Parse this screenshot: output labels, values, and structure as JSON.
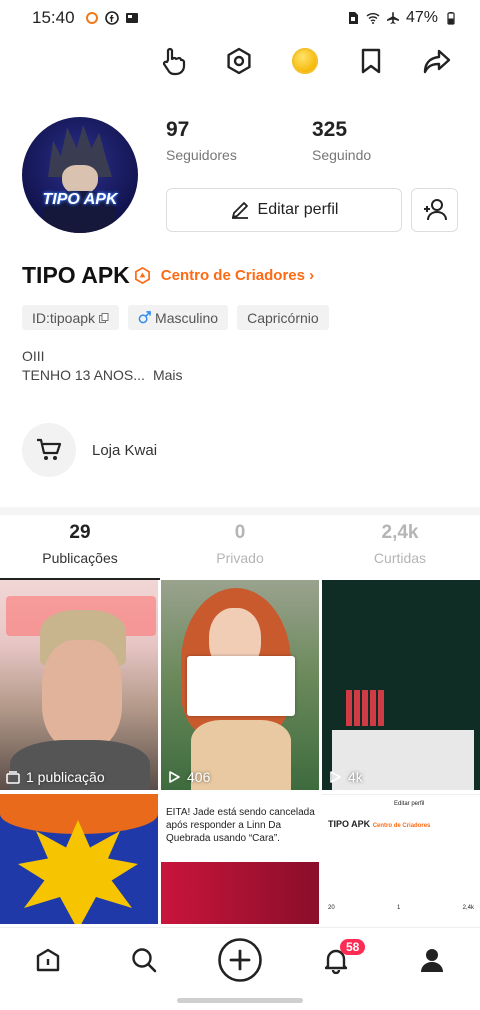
{
  "status_bar": {
    "time": "15:40",
    "battery": "47%",
    "icons": [
      "notification-app-icon",
      "facebook-icon",
      "media-icon",
      "sim-icon",
      "wifi-icon",
      "airplane-icon",
      "battery-icon"
    ]
  },
  "top_actions": {
    "icons": [
      "tap-hand-icon",
      "settings-hexagon-icon",
      "coin-icon",
      "bookmark-icon",
      "share-icon"
    ]
  },
  "profile": {
    "avatar_text": "TIPO APK",
    "followers_count": "97",
    "followers_label": "Seguidores",
    "following_count": "325",
    "following_label": "Seguindo",
    "edit_button_label": "Editar perfil",
    "name": "TIPO APK",
    "creator_center_link": "Centro de Criadores ›",
    "tags": [
      "ID:tipoapk",
      "Masculino",
      "Capricórnio"
    ],
    "bio_line1": "OIII",
    "bio_line2": "TENHO 13 ANOS...",
    "bio_more": "Mais",
    "shop_label": "Loja Kwai"
  },
  "tabs": [
    {
      "count": "29",
      "label": "Publicações",
      "active": true
    },
    {
      "count": "0",
      "label": "Privado",
      "active": false
    },
    {
      "count": "2,4k",
      "label": "Curtidas",
      "active": false
    }
  ],
  "grid": {
    "cell1_caption": "1 publicação",
    "cell2_views": "406",
    "cell3_views": "4k",
    "cell5_text": "EITA! Jade está sendo cancelada após responder a Linn Da Quebrada usando “Cara”.",
    "cell6_name": "TIPO APK",
    "cell6_link": "Centro de Criadores",
    "cell6_edit": "Editar perfil",
    "cell6_stats": [
      "20",
      "1",
      "2,4k"
    ]
  },
  "bottom_nav": {
    "items": [
      "home-icon",
      "search-icon",
      "create-plus-icon",
      "notifications-bell-icon",
      "profile-icon"
    ],
    "notification_badge": "58"
  },
  "colors": {
    "accent_orange": "#ff6a14",
    "badge_red": "#fe2c55",
    "text_dark": "#222222"
  }
}
